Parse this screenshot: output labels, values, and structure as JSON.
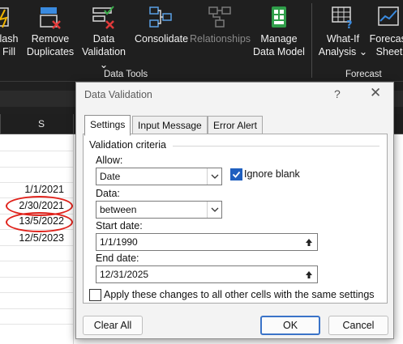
{
  "ribbon": {
    "flash_fill": "lash\nFill",
    "remove_duplicates": "Remove\nDuplicates",
    "data_validation": "Data\nValidation ⌄",
    "consolidate": "Consolidate",
    "relationships": "Relationships",
    "manage_data_model": "Manage\nData Model",
    "what_if_analysis": "What-If\nAnalysis ⌄",
    "forecast_sheet": "Forecast\nSheet",
    "group_data_tools": "Data Tools",
    "group_forecast": "Forecast"
  },
  "sheet": {
    "column_header": "S",
    "cells": [
      "1/1/2021",
      "2/30/2021",
      "13/5/2022",
      "12/5/2023"
    ]
  },
  "dialog": {
    "title": "Data Validation",
    "help": "?",
    "close": "✕",
    "tabs": [
      "Settings",
      "Input Message",
      "Error Alert"
    ],
    "validation_criteria": "Validation criteria",
    "allow_label": "Allow:",
    "allow_value": "Date",
    "ignore_blank_label": "Ignore blank",
    "ignore_blank_checked": true,
    "data_label": "Data:",
    "data_value": "between",
    "start_date_label": "Start date:",
    "start_date_value": "1/1/1990",
    "end_date_label": "End date:",
    "end_date_value": "12/31/2025",
    "apply_all_label": "Apply these changes to all other cells with the same settings",
    "apply_all_checked": false,
    "clear_all_label": "Clear All",
    "ok_label": "OK",
    "cancel_label": "Cancel"
  },
  "colors": {
    "ribbon_bg": "#1f1f1f",
    "accent": "#3a73c8",
    "highlight_oval": "#e0221b",
    "checkbox_on": "#1f5fbf"
  }
}
